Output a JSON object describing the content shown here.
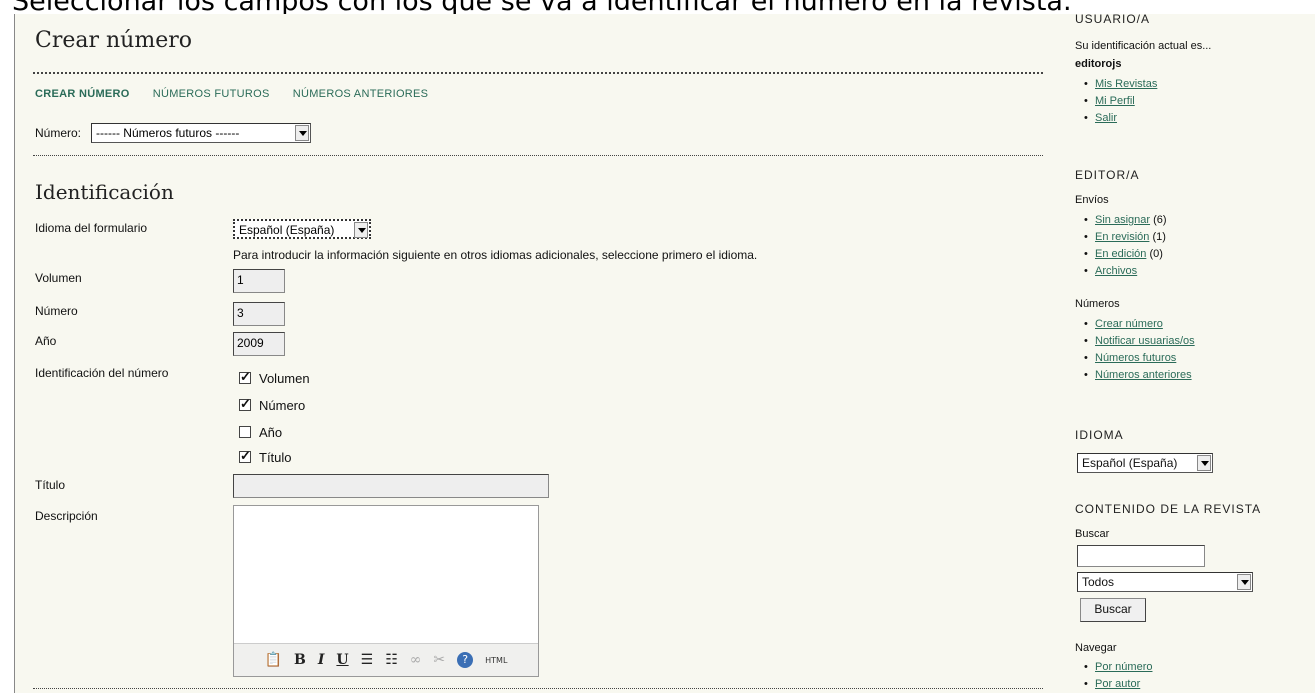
{
  "caption": "Seleccionar los campos con los que se va a identificar el número en la revista.",
  "main": {
    "title": "Crear número",
    "tabs": [
      "CREAR NÚMERO",
      "NÚMEROS FUTUROS",
      "NÚMEROS ANTERIORES"
    ],
    "issue_select_label": "Número:",
    "issue_select_value": "------ Números futuros ------",
    "section_title": "Identificación",
    "form_language_label": "Idioma del formulario",
    "form_language_value": "Español (España)",
    "form_language_hint": "Para introducir la información siguiente en otros idiomas adicionales, seleccione primero el idioma.",
    "volume_label": "Volumen",
    "volume_value": "1",
    "number_label": "Número",
    "number_value": "3",
    "year_label": "Año",
    "year_value": "2009",
    "identification_label": "Identificación del número",
    "identification_options": [
      {
        "label": "Volumen",
        "checked": true
      },
      {
        "label": "Número",
        "checked": true
      },
      {
        "label": "Año",
        "checked": false
      },
      {
        "label": "Título",
        "checked": true
      }
    ],
    "title_label": "Título",
    "title_value": "",
    "description_label": "Descripción",
    "editor_toolbar": [
      "paste-word-icon",
      "bold-icon",
      "italic-icon",
      "underline-icon",
      "bullet-list-icon",
      "numbered-list-icon",
      "link-icon",
      "unlink-icon",
      "help-icon",
      "html-icon"
    ],
    "toolbar_labels": {
      "bold": "B",
      "italic": "I",
      "underline": "U",
      "html": "HTML"
    }
  },
  "sidebar": {
    "user_heading": "USUARIO/A",
    "user_text": "Su identificación actual es...",
    "username": "editorojs",
    "user_links": [
      "Mis Revistas",
      "Mi Perfil",
      "Salir"
    ],
    "editor_heading": "EDITOR/A",
    "submissions_label": "Envíos",
    "submissions": [
      {
        "label": "Sin asignar",
        "count": "(6)"
      },
      {
        "label": "En revisión",
        "count": "(1)"
      },
      {
        "label": "En edición",
        "count": "(0)"
      },
      {
        "label": "Archivos",
        "count": ""
      }
    ],
    "issues_label": "Números",
    "issue_links": [
      "Crear número",
      "Notificar usuarias/os",
      "Números futuros",
      "Números anteriores"
    ],
    "language_heading": "IDIOMA",
    "language_value": "Español (España)",
    "content_heading": "CONTENIDO DE LA REVISTA",
    "search_label": "Buscar",
    "search_value": "",
    "search_scope": "Todos",
    "search_button": "Buscar",
    "browse_label": "Navegar",
    "browse_links": [
      "Por número",
      "Por autor"
    ]
  }
}
